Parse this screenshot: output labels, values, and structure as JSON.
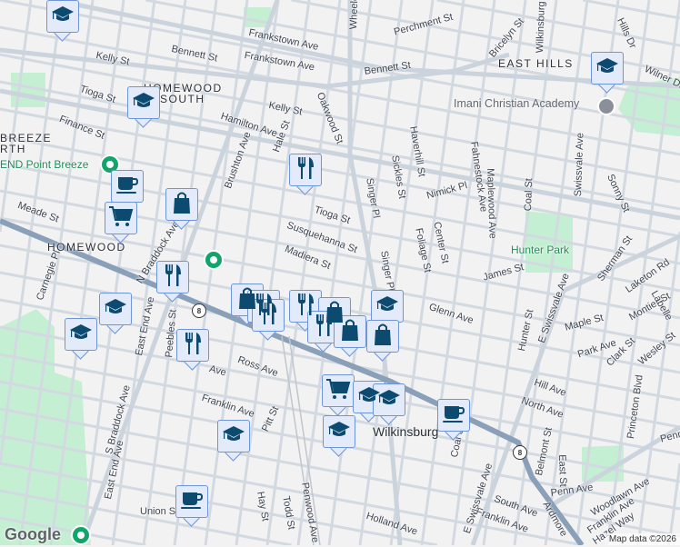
{
  "map": {
    "attribution": "Map data ©2026",
    "logo": "Google",
    "route_shield": "8",
    "colors": {
      "background": "#f3f2f3",
      "road": "#d2d9e1",
      "highway": "#8aa0b8",
      "park": "#c5efd3",
      "marker_fill": "#e3ebfb",
      "marker_border": "#6d95d8",
      "icon": "#0d4a6f",
      "place_pin": "#12a46b"
    }
  },
  "neighborhoods": [
    "HOMEWOOD",
    "SOUTH",
    "EAST HILLS",
    "HOMEWOOD",
    "BREEZE",
    "RTH",
    "Wilkinsburg"
  ],
  "places": [
    "Imani Christian Academy",
    "Hunter Park",
    "END Point Breeze"
  ],
  "streets": [
    "Frankstown Ave",
    "Frankstown Ave",
    "Bennett St",
    "Bennett St",
    "Kelly St",
    "Kelly St",
    "Tioga St",
    "Tioga St",
    "Hamilton Ave",
    "Finance St",
    "Oakwood St",
    "Hale St",
    "Brushton Ave",
    "Susquehanna St",
    "Madiera St",
    "Meade St",
    "N Braddock Ave",
    "Carnegie Pl",
    "Peebles St",
    "East End Ave",
    "East End Ave",
    "S Braddock Ave",
    "Ross Ave",
    "Franklin Ave",
    "Pitt St",
    "Union St",
    "Hay St",
    "Todd St",
    "Penwood Ave",
    "Holland Ave",
    "Perchment St",
    "Bricelyn St",
    "Wilkinsburg",
    "Wilner Dr",
    "Haverhill St",
    "Sickles St",
    "Nimick Pl",
    "Singer Pl",
    "Singer Pl",
    "Fahnestock Ave",
    "Maplewood Ave",
    "Coal St",
    "Swissvale Ave",
    "Sonny St",
    "Foliage St",
    "Center St",
    "James St",
    "Sherman St",
    "Laketon Rd",
    "Montier St",
    "Glenn Ave",
    "Maple St",
    "Hunter St",
    "E Swissvale Ave",
    "Park Ave",
    "Clark St",
    "Wesley St",
    "Hill Ave",
    "North Ave",
    "Princeton Blvd",
    "Belmont St",
    "East St",
    "Penn Ave",
    "Penn Ave",
    "Woodlawn Ave",
    "South Ave",
    "Franklin Ave",
    "E Swissvale Ave",
    "Ardmore",
    "Hazel Way",
    "Franklin Ave",
    "Coal St",
    "Labelle",
    "Ave",
    "Wheeler St",
    "Hills Dr"
  ],
  "markers": [
    "school",
    "school",
    "coffee",
    "grocery",
    "shopping",
    "restaurant",
    "restaurant",
    "school",
    "school",
    "restaurant",
    "shopping",
    "restaurant",
    "restaurant",
    "restaurant",
    "shopping",
    "school",
    "shopping",
    "restaurant",
    "shopping",
    "grocery",
    "school",
    "school",
    "coffee",
    "school",
    "school",
    "coffee",
    "school"
  ]
}
